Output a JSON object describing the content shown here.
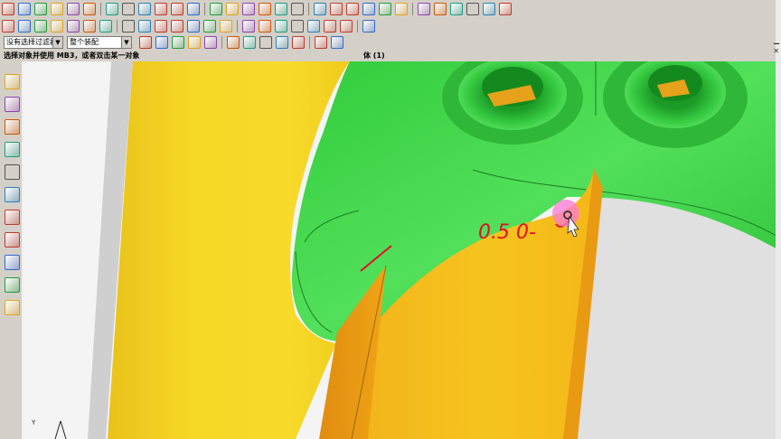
{
  "toolbar_top": {
    "icons": [
      "line-icon",
      "arc-icon",
      "rectangle-icon",
      "spline-icon",
      "text-icon",
      "fillet-icon",
      "mirror-icon",
      "offset-icon",
      "grid-icon",
      "table-icon",
      "extrude-icon",
      "box-icon",
      "cylinder-icon",
      "hole-icon",
      "blend-icon",
      "chamfer-icon",
      "shell-icon",
      "pattern-icon",
      "trim-icon",
      "edit-icon",
      "surface-icon",
      "note-icon",
      "dimension-icon",
      "weld-icon",
      "view-icon",
      "analysis-icon",
      "feature-icon",
      "measure-icon",
      "render-icon",
      "tools-icon"
    ]
  },
  "toolbar_mid": {
    "icons": [
      "point-icon",
      "plane-icon",
      "axis-icon",
      "csys-icon",
      "sketch-icon",
      "sphere-icon",
      "cone-icon",
      "union-icon",
      "subtract-icon",
      "intersect-icon",
      "draft-icon",
      "curve-icon",
      "project-icon",
      "wrap-icon",
      "thicken-icon",
      "sew-icon",
      "sweep-icon",
      "loft-icon",
      "revolve-icon",
      "rib-icon",
      "snap-icon",
      "layer-icon"
    ]
  },
  "selection_bar": {
    "filter_label": "没有选择过滤器",
    "scope_label": "整个装配",
    "snap_icons": [
      "select-icon",
      "filter-icon",
      "undo-select-icon",
      "magnet-icon",
      "box-select-icon",
      "cube-select-icon",
      "snap-end-icon",
      "snap-mid-icon",
      "snap-center-icon",
      "snap-point-icon",
      "snap-cross-icon",
      "snap-tangent-icon"
    ]
  },
  "status": {
    "prompt": "选择对象并使用 MB3，或者双击某一对象",
    "selection": "体 (1)"
  },
  "resource_bar": {
    "icons": [
      "assembly-navigator-icon",
      "constraint-navigator-icon",
      "part-navigator-icon",
      "reuse-library-icon",
      "web-browser-icon",
      "history-icon",
      "system-materials-icon",
      "process-studio-icon",
      "roles-icon",
      "palette-icon",
      "render-icon"
    ]
  },
  "annotation": {
    "handwritten": "0.5 0-"
  },
  "colors": {
    "green_body": "#3cd84a",
    "yellow_body": "#f4cc1c",
    "orange_face": "#f0a814",
    "cursor_highlight": "#ff7ad8",
    "annotation_ink": "#e0102a"
  },
  "viewport": {
    "csys_label": "Y"
  }
}
